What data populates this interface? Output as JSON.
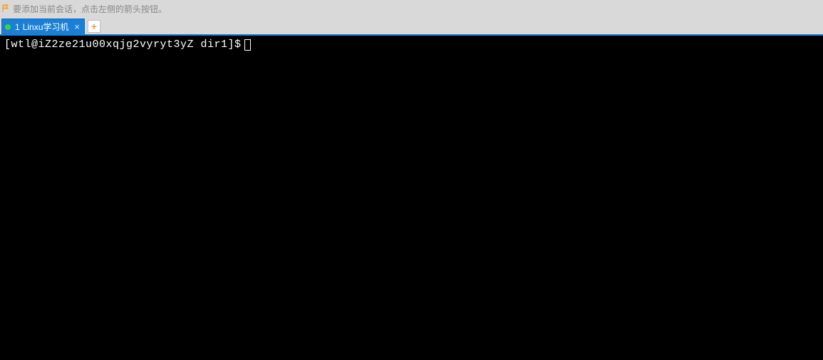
{
  "hint": {
    "text": "要添加当前会话，点击左侧的箭头按钮。"
  },
  "tabs": {
    "active": {
      "number": "1",
      "label": "Linxu学习机"
    }
  },
  "terminal": {
    "prompt": "[wtl@iZ2ze21u00xqjg2vyryt3yZ dir1]$"
  },
  "icons": {
    "close": "×",
    "plus": "+"
  }
}
